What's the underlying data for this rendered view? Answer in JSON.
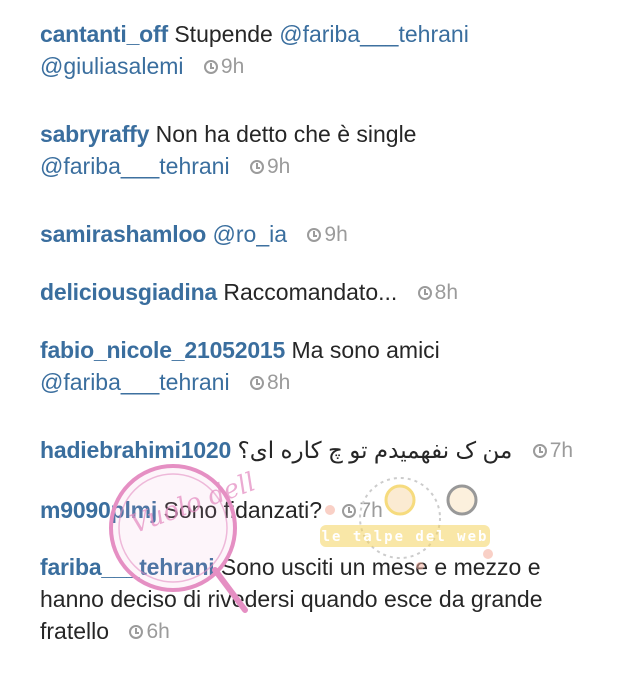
{
  "comments": [
    {
      "user": "cantanti_off",
      "text": "Stupende",
      "mentions": [
        "@fariba___tehrani",
        "@giuliasalemi"
      ],
      "time": "9h"
    },
    {
      "user": "sabryraffy",
      "text": "Non ha detto che è single",
      "mention": "@fariba___tehrani",
      "time": "9h"
    },
    {
      "user": "samirashamloo",
      "mention": "@ro_ia",
      "time": "9h"
    },
    {
      "user": "deliciousgiadina",
      "text": "Raccomandato...",
      "time": "8h"
    },
    {
      "user": "fabio_nicole_21052015",
      "text": "Ma sono amici",
      "mention": "@fariba___tehrani",
      "time": "8h"
    },
    {
      "user": "hadiebrahimi1020",
      "text": "من ک نفهمیدم تو چ کاره ای؟",
      "time": "7h"
    },
    {
      "user": "m9090plmj",
      "text": "Sono fidanzati?",
      "time": "7h"
    },
    {
      "user": "fariba___tehrani",
      "text": "Sono usciti un mese e mezzo e hanno deciso di rivedersi quando esce da grande fratello",
      "time": "6h"
    }
  ],
  "watermark": {
    "seal_text": "Vuolo della Luss",
    "banner_text": "le talpe del web"
  },
  "colors": {
    "username": "#3a6e9e",
    "text": "#262626",
    "time": "#9b9b9b",
    "seal": "#e58fc3",
    "banner": "#f4d35e"
  }
}
